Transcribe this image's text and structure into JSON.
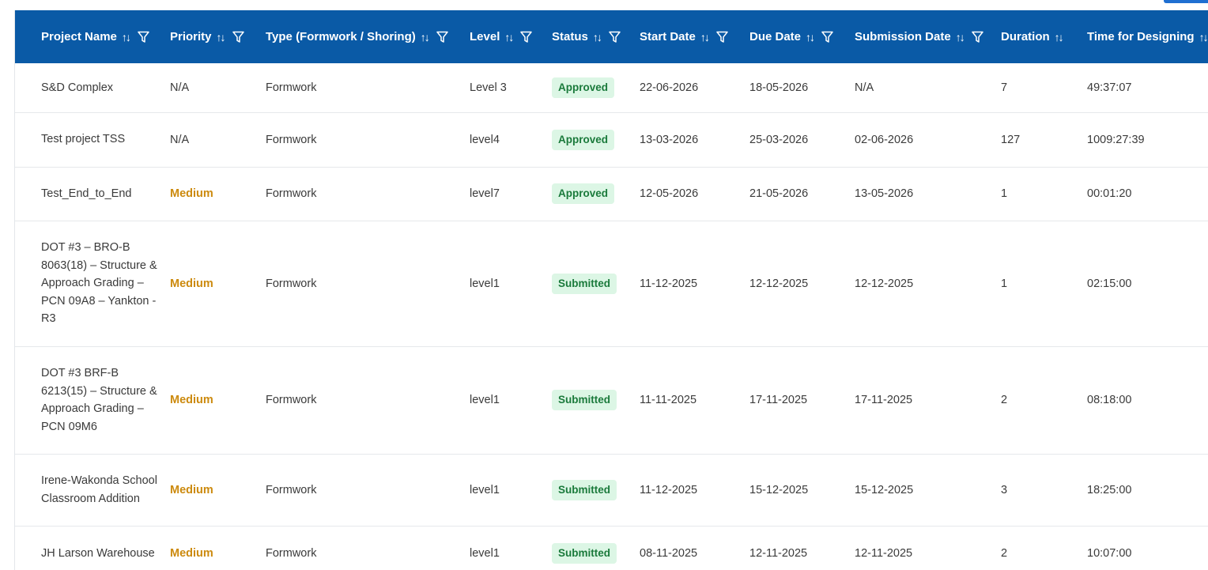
{
  "table": {
    "columns": [
      {
        "label": "Project Name",
        "sortable": true,
        "filterable": true
      },
      {
        "label": "Priority",
        "sortable": true,
        "filterable": true
      },
      {
        "label": "Type (Formwork / Shoring)",
        "sortable": true,
        "filterable": true
      },
      {
        "label": "Level",
        "sortable": true,
        "filterable": true
      },
      {
        "label": "Status",
        "sortable": true,
        "filterable": true
      },
      {
        "label": "Start Date",
        "sortable": true,
        "filterable": true
      },
      {
        "label": "Due Date",
        "sortable": true,
        "filterable": true
      },
      {
        "label": "Submission Date",
        "sortable": true,
        "filterable": true
      },
      {
        "label": "Duration",
        "sortable": true,
        "filterable": false
      },
      {
        "label": "Time for Designing",
        "sortable": true,
        "filterable": false
      }
    ],
    "sort_glyph": "↑↓",
    "rows": [
      {
        "name": "S&D Complex",
        "priority": "N/A",
        "priority_style": "plain",
        "type": "Formwork",
        "level": "Level 3",
        "status": "Approved",
        "start": "22-06-2026",
        "due": "18-05-2026",
        "submission": "N/A",
        "duration": "7",
        "design_time": "49:37:07"
      },
      {
        "name": "Test project TSS",
        "priority": "N/A",
        "priority_style": "plain",
        "type": "Formwork",
        "level": "level4",
        "status": "Approved",
        "start": "13-03-2026",
        "due": "25-03-2026",
        "submission": "02-06-2026",
        "duration": "127",
        "design_time": "1009:27:39"
      },
      {
        "name": "Test_End_to_End",
        "priority": "Medium",
        "priority_style": "medium",
        "type": "Formwork",
        "level": "level7",
        "status": "Approved",
        "start": "12-05-2026",
        "due": "21-05-2026",
        "submission": "13-05-2026",
        "duration": "1",
        "design_time": "00:01:20"
      },
      {
        "name": "DOT #3 – BRO-B 8063(18) – Structure & Approach Grading – PCN 09A8 – Yankton - R3",
        "priority": "Medium",
        "priority_style": "medium",
        "type": "Formwork",
        "level": "level1",
        "status": "Submitted",
        "start": "11-12-2025",
        "due": "12-12-2025",
        "submission": "12-12-2025",
        "duration": "1",
        "design_time": "02:15:00"
      },
      {
        "name": "DOT #3 BRF-B 6213(15) – Structure & Approach Grading – PCN 09M6",
        "priority": "Medium",
        "priority_style": "medium",
        "type": "Formwork",
        "level": "level1",
        "status": "Submitted",
        "start": "11-11-2025",
        "due": "17-11-2025",
        "submission": "17-11-2025",
        "duration": "2",
        "design_time": "08:18:00"
      },
      {
        "name": "Irene-Wakonda School Classroom Addition",
        "priority": "Medium",
        "priority_style": "medium",
        "type": "Formwork",
        "level": "level1",
        "status": "Submitted",
        "start": "11-12-2025",
        "due": "15-12-2025",
        "submission": "15-12-2025",
        "duration": "3",
        "design_time": "18:25:00"
      },
      {
        "name": "JH Larson Warehouse",
        "priority": "Medium",
        "priority_style": "medium",
        "type": "Formwork",
        "level": "level1",
        "status": "Submitted",
        "start": "08-11-2025",
        "due": "12-11-2025",
        "submission": "12-11-2025",
        "duration": "2",
        "design_time": "10:07:00"
      }
    ]
  },
  "colors": {
    "header_bg": "#0a5aa6",
    "medium_priority": "#cc8a0e",
    "badge_bg": "#dcf6e5",
    "badge_text": "#1a7a3b"
  },
  "icons": {
    "sort": "sort-arrows-icon",
    "filter": "filter-funnel-icon"
  }
}
